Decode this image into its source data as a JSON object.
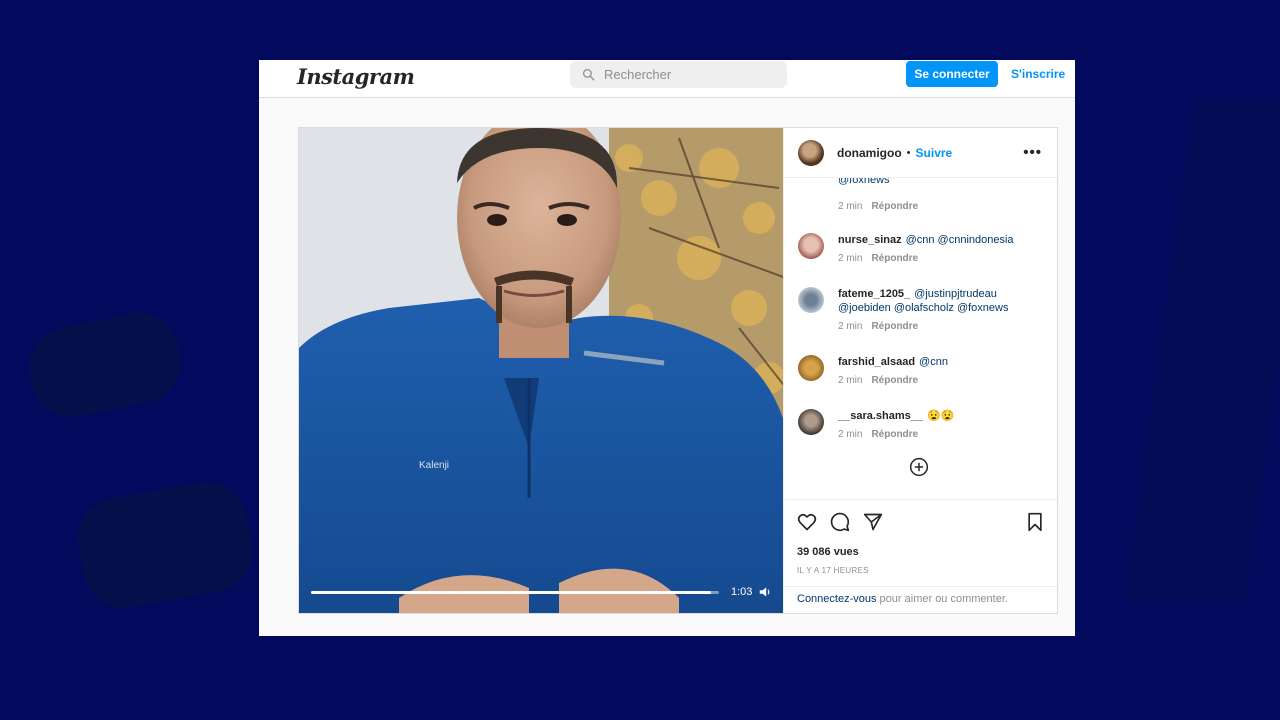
{
  "nav": {
    "logo": "Instagram",
    "search_placeholder": "Rechercher",
    "login_label": "Se connecter",
    "signup_label": "S'inscrire"
  },
  "post": {
    "username": "donamigoo",
    "separator": "•",
    "follow_label": "Suivre",
    "more_label": "•••",
    "video": {
      "time": "1:03",
      "progress_fraction": 0.98
    }
  },
  "comments": {
    "top_fragment": {
      "mention": "@foxnews",
      "time": "2 min",
      "reply": "Répondre"
    },
    "items": [
      {
        "user": "nurse_sinaz",
        "text": "@cnn @cnnindonesia",
        "time": "2 min",
        "reply": "Répondre"
      },
      {
        "user": "fateme_1205_",
        "text": "@justinpjtrudeau @joebiden @olafscholz @foxnews",
        "time": "2 min",
        "reply": "Répondre"
      },
      {
        "user": "farshid_alsaad",
        "text": "@cnn",
        "time": "2 min",
        "reply": "Répondre"
      },
      {
        "user": "__sara.shams__",
        "text": "😧😧",
        "time": "2 min",
        "reply": "Répondre"
      }
    ]
  },
  "actions": {
    "views": "39 086 vues",
    "ago": "IL Y A 17 HEURES",
    "login_link": "Connectez-vous",
    "login_suffix": " pour aimer ou commenter."
  },
  "colors": {
    "accent": "#0095f6",
    "mention": "#00376b",
    "background": "#030a5e"
  },
  "icons": [
    "search-icon",
    "more-icon",
    "add-comment-icon",
    "heart-icon",
    "comment-icon",
    "share-icon",
    "bookmark-icon",
    "volume-icon"
  ]
}
